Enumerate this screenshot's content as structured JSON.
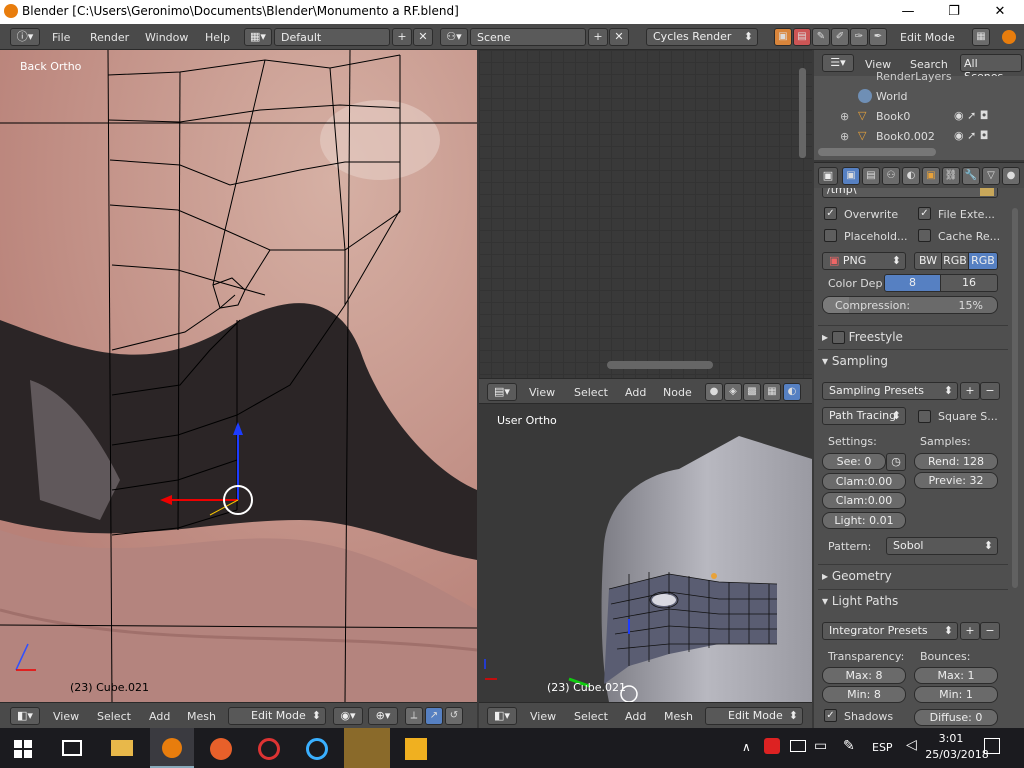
{
  "window": {
    "title": "Blender [C:\\Users\\Geronimo\\Documents\\Blender\\Monumento a RF.blend]",
    "min": "—",
    "max": "❐",
    "close": "✕"
  },
  "topbar": {
    "menus": [
      "File",
      "Render",
      "Window",
      "Help"
    ],
    "layout": "Default",
    "scene": "Scene",
    "engine": "Cycles Render",
    "mode": "Edit Mode"
  },
  "viewport_left": {
    "label": "Back Ortho",
    "object": "(23) Cube.021",
    "menus": [
      "View",
      "Select",
      "Add",
      "Mesh"
    ],
    "mode": "Edit Mode"
  },
  "node_editor": {
    "menus": [
      "View",
      "Select",
      "Add",
      "Node"
    ]
  },
  "viewport_right": {
    "label": "User Ortho",
    "object": "(23) Cube.021",
    "menus": [
      "View",
      "Select",
      "Add",
      "Mesh"
    ],
    "mode": "Edit Mode"
  },
  "outliner": {
    "menus": [
      "View",
      "Search"
    ],
    "filter": "All Scenes",
    "items": [
      "RenderLayers",
      "World",
      "Book0",
      "Book0.002"
    ]
  },
  "properties": {
    "path": "/tmp\\",
    "overwrite": "Overwrite",
    "file_ext": "File Exte...",
    "placeholder": "Placehold...",
    "cache": "Cache Re...",
    "format": "PNG",
    "bw": "BW",
    "rgb": "RGB",
    "rgba": "RGB",
    "color_depth_label": "Color Dep",
    "depth_8": "8",
    "depth_16": "16",
    "compression_label": "Compression:",
    "compression_value": "15%",
    "compression_fraction": 0.15,
    "freestyle": "Freestyle",
    "sampling": "Sampling",
    "sampling_presets": "Sampling Presets",
    "path_tracing": "Path Tracing",
    "square_samples": "Square S...",
    "settings": "Settings:",
    "samples": "Samples:",
    "seed": "See:",
    "seed_val": "0",
    "clamp1": "Clam:",
    "clamp1_val": "0.00",
    "clamp2": "Clam:",
    "clamp2_val": "0.00",
    "light": "Light:",
    "light_val": "0.01",
    "render": "Rend:",
    "render_val": "128",
    "preview": "Previe:",
    "preview_val": "32",
    "pattern_label": "Pattern:",
    "pattern": "Sobol",
    "geometry": "Geometry",
    "light_paths": "Light Paths",
    "integrator_presets": "Integrator Presets",
    "transparency": "Transparency:",
    "bounces": "Bounces:",
    "t_max": "Max:",
    "t_max_val": "8",
    "t_min": "Min:",
    "t_min_val": "8",
    "b_max": "Max:",
    "b_max_val": "1",
    "b_min": "Min:",
    "b_min_val": "1",
    "shadows": "Shadows",
    "diffuse": "Diffuse:",
    "diffuse_val": "0"
  },
  "taskbar": {
    "lang": "ESP",
    "time": "3:01",
    "date": "25/03/2018"
  },
  "colors": {
    "accent_blue": "#5680c2",
    "blender_orange": "#e87d0d"
  }
}
